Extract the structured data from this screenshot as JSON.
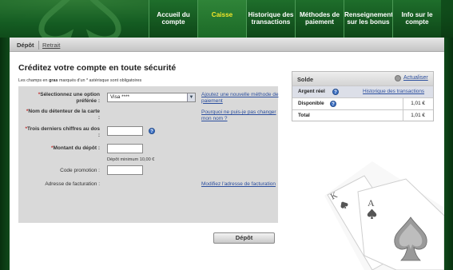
{
  "nav": {
    "items": [
      {
        "label": "Accueil du compte",
        "active": false
      },
      {
        "label": "Caisse",
        "active": true
      },
      {
        "label": "Historique des transactions",
        "active": false
      },
      {
        "label": "Méthodes de paiement",
        "active": false
      },
      {
        "label": "Renseignements sur les bonus",
        "active": false
      },
      {
        "label": "Info sur le compte",
        "active": false
      }
    ]
  },
  "subnav": {
    "active": "Dépôt",
    "link": "Retrait"
  },
  "page": {
    "title": "Créditez votre compte en toute sécurité",
    "note_prefix": "Les champs en ",
    "note_bold": "gras",
    "note_suffix": " marqués d'un * astérisque sont obligatoires"
  },
  "form": {
    "option_label": "Sélectionnez une option préférée :",
    "option_value": "Visa ****",
    "add_method_link": "Ajoutez une nouvelle méthode de paiement",
    "holder_label": "Nom du détenteur de la carte :",
    "holder_link": "Pourquoi ne puis-je pas changer mon nom ?",
    "digits_label": "Trois derniers chiffres au dos :",
    "help_glyph": "?",
    "amount_label": "Montant du dépôt :",
    "min_hint": "Dépôt minimum 10,00 €",
    "promo_label": "Code promotion :",
    "billing_label": "Adresse de facturation :",
    "billing_link": "Modifiez l'adresse de facturation",
    "submit_label": "Dépôt",
    "required_star": "*"
  },
  "balance": {
    "title": "Solde",
    "refresh_link": "Actualiser",
    "real_label": "Argent réel",
    "history_link": "Historique des transactions",
    "available_label": "Disponible",
    "available_value": "1,01 €",
    "total_label": "Total",
    "total_value": "1,01 €"
  },
  "colors": {
    "brand_green": "#0c3a13",
    "active_tab_text": "#f2e52a",
    "link_blue": "#2c4f9e",
    "required_star": "#c03030"
  },
  "icons": [
    "spade-logo-icon",
    "chevron-down-icon",
    "help-icon",
    "refresh-icon",
    "playing-cards-icon"
  ]
}
